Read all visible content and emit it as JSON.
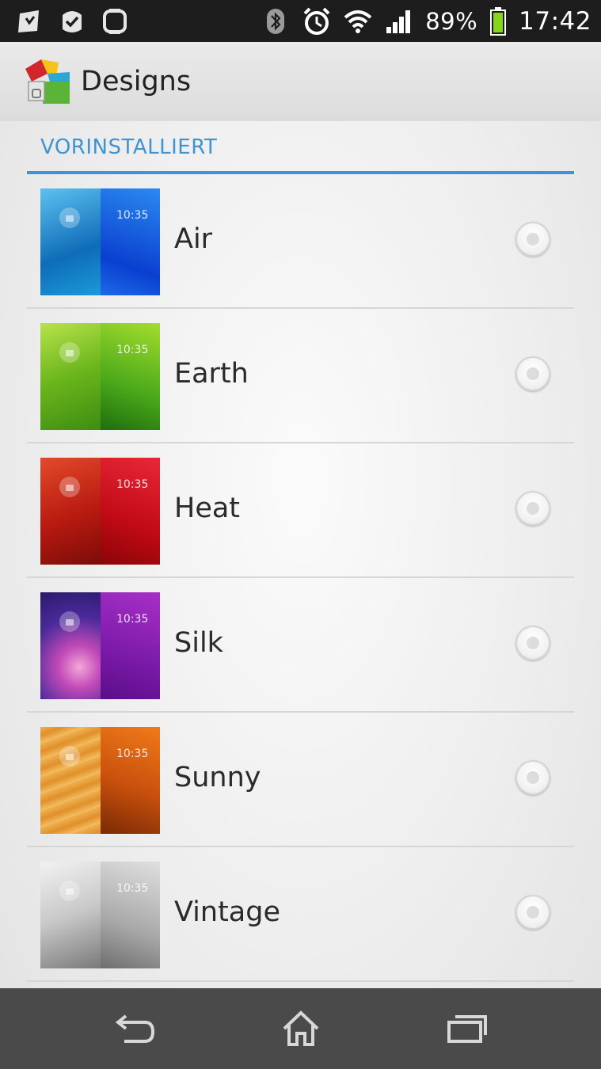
{
  "status_bar": {
    "left_icons": [
      "store-notification-icon",
      "check-notification-icon",
      "watch-notification-icon"
    ],
    "right_icons": [
      "bluetooth-icon",
      "alarm-icon",
      "wifi-icon",
      "signal-icon",
      "battery-icon"
    ],
    "battery": "89%",
    "time": "17:42"
  },
  "action_bar": {
    "title": "Designs",
    "icon": "themes-app-icon"
  },
  "section": {
    "title": "VORINSTALLIERT"
  },
  "themes": [
    {
      "name": "Air",
      "time": "10:35",
      "colors": [
        "#1c78c4",
        "#0b55d6"
      ]
    },
    {
      "name": "Earth",
      "time": "10:35",
      "colors": [
        "#7fc51e",
        "#3d9a12"
      ]
    },
    {
      "name": "Heat",
      "time": "10:35",
      "colors": [
        "#c62516",
        "#d10b18"
      ]
    },
    {
      "name": "Silk",
      "time": "10:35",
      "colors": [
        "#4f2aa0",
        "#8a1fb0"
      ]
    },
    {
      "name": "Sunny",
      "time": "10:35",
      "colors": [
        "#e59a3a",
        "#c85a10"
      ]
    },
    {
      "name": "Vintage",
      "time": "10:35",
      "colors": [
        "#bdbdbd",
        "#8f8f8f"
      ]
    }
  ],
  "nav_bar": {
    "buttons": [
      "back-icon",
      "home-icon",
      "recents-icon"
    ]
  },
  "colors": {
    "accent": "#3e94d1",
    "status_bar": "#1d1d1d",
    "nav_bar": "#4a4a4a"
  }
}
